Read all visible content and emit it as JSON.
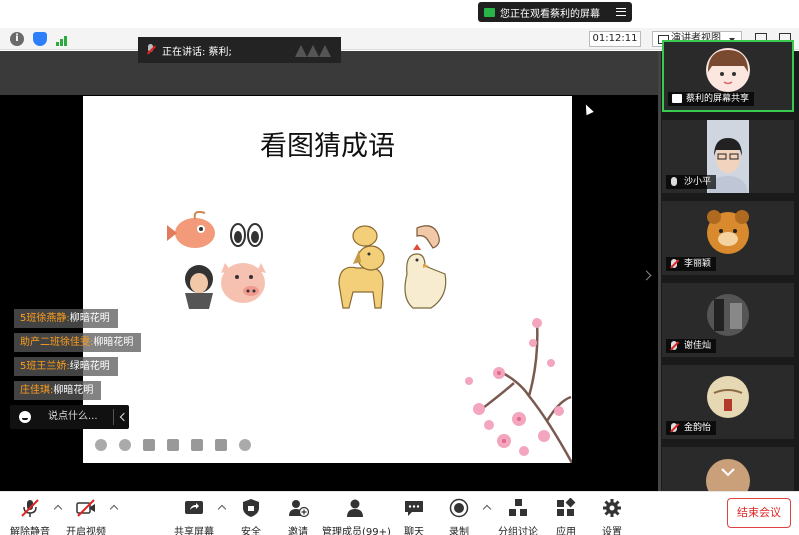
{
  "banner": {
    "text": "您正在观看蔡利的屏幕"
  },
  "infobar": {
    "timer": "01:12:11",
    "view_mode": "演讲者视图"
  },
  "speaking": {
    "text": "正在讲话: 蔡利;"
  },
  "slide": {
    "title": "看图猜成语"
  },
  "chat": {
    "messages": [
      {
        "sender": "5班徐燕静:",
        "text": "柳暗花明"
      },
      {
        "sender": "助产二班徐佳雯:",
        "text": "柳暗花明"
      },
      {
        "sender": "5班王兰娇:",
        "text": "绿暗花明"
      },
      {
        "sender": "庄佳琪:",
        "text": "柳暗花明"
      }
    ],
    "input_placeholder": "说点什么..."
  },
  "participants": [
    {
      "name": "蔡利的屏幕共享",
      "mic": "on",
      "sharing": true
    },
    {
      "name": "沙小平",
      "mic": "on"
    },
    {
      "name": "李丽颖",
      "mic": "off"
    },
    {
      "name": "谢佳灿",
      "mic": "off"
    },
    {
      "name": "金韵怡",
      "mic": "off"
    }
  ],
  "toolbar": {
    "unmute": "解除静音",
    "start_video": "开启视频",
    "share_screen": "共享屏幕",
    "security": "安全",
    "invite": "邀请",
    "manage": "管理成员(99+)",
    "chat": "聊天",
    "record": "录制",
    "breakout": "分组讨论",
    "apps": "应用",
    "settings": "设置",
    "end_meeting": "结束会议"
  },
  "colors": {
    "accent_green": "#38c94e",
    "danger_red": "#e02424",
    "chat_name": "#ff9f1c"
  }
}
